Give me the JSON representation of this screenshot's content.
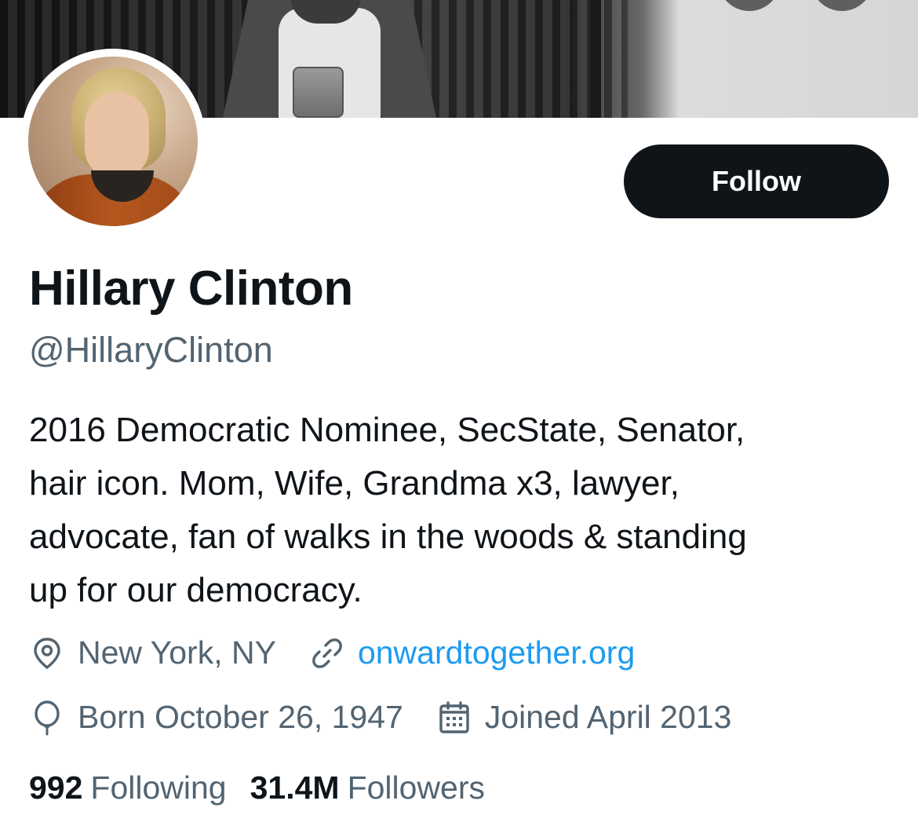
{
  "profile": {
    "display_name": "Hillary Clinton",
    "handle": "@HillaryClinton",
    "follow_label": "Follow",
    "bio_lines": [
      "2016 Democratic Nominee, SecState, Senator,",
      "hair icon. Mom, Wife, Grandma x3, lawyer,",
      "advocate, fan of walks in the woods & standing",
      "up for our democracy."
    ],
    "location": "New York, NY",
    "website": "onwardtogether.org",
    "born": "Born October 26, 1947",
    "joined": "Joined April 2013",
    "following_count": "992",
    "following_label": "Following",
    "followers_count": "31.4M",
    "followers_label": "Followers"
  },
  "icons": {
    "location": "location-pin-icon",
    "website": "link-icon",
    "born": "balloon-icon",
    "joined": "calendar-icon"
  },
  "colors": {
    "text_primary": "#0f1419",
    "text_secondary": "#536471",
    "link": "#1d9bf0",
    "follow_button_bg": "#0f1419",
    "follow_button_text": "#ffffff"
  }
}
